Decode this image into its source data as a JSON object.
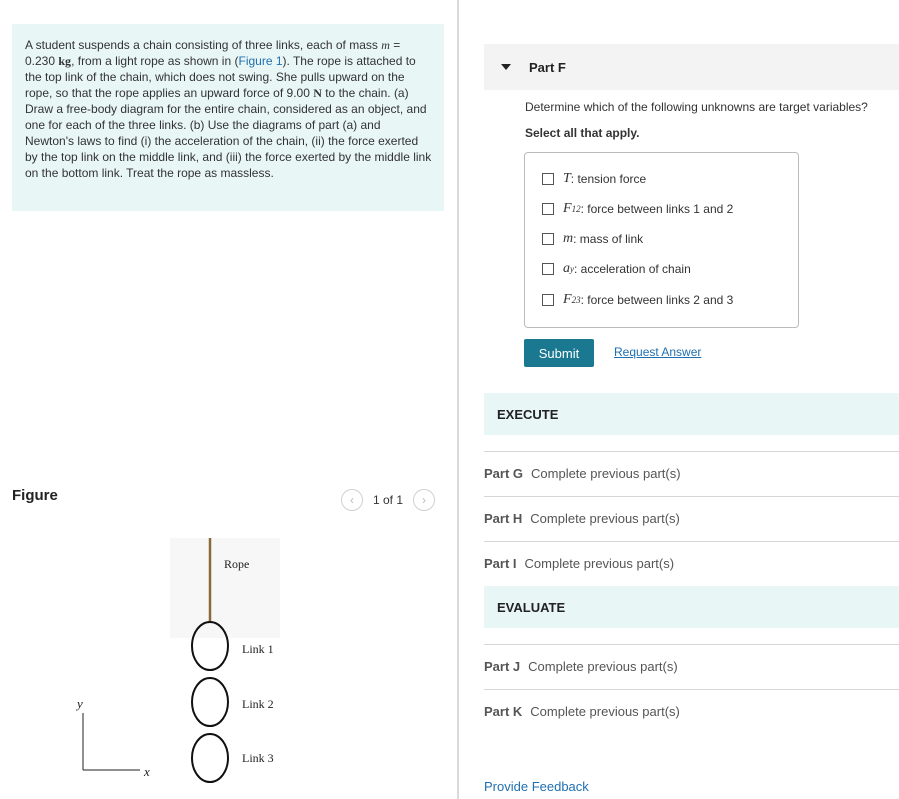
{
  "problem": {
    "text_1": "A student suspends a chain consisting of three links, each of mass",
    "mass_symbol": "m",
    "mass_eq": " = 0.230 ",
    "mass_unit": "kg",
    "text_2": ", from a light rope as shown in (",
    "figure_link": "Figure 1",
    "text_3": "). The rope is attached to the top link of the chain, which does not swing. She pulls upward on the rope, so that the rope applies an upward force of",
    "force_value": "9.00 ",
    "force_unit": "N",
    "text_4": " to the chain. (a) Draw a free-body diagram for the entire chain, considered as an object, and one for each of the three links. (b) Use the diagrams of part (a) and Newton's laws to find (i) the acceleration of the chain, (ii) the force exerted by the top link on the middle link, and (iii) the force exerted by the middle link on the bottom link. Treat the rope as massless."
  },
  "figure": {
    "title": "Figure",
    "pager_text": "1 of 1",
    "prev_icon": "chevron-left-icon",
    "next_icon": "chevron-right-icon",
    "labels": {
      "rope": "Rope",
      "link1": "Link 1",
      "link2": "Link 2",
      "link3": "Link 3",
      "y_axis": "y",
      "x_axis": "x"
    }
  },
  "part_f": {
    "title": "Part F",
    "question": "Determine which of the following unknowns are target variables?",
    "instruction": "Select all that apply.",
    "options": [
      {
        "symbol": "T",
        "sub": "",
        "desc": ": tension force",
        "checked": false
      },
      {
        "symbol": "F",
        "sub": "12",
        "desc": ": force between links 1 and 2",
        "checked": false
      },
      {
        "symbol": "m",
        "sub": "",
        "desc": ": mass of link",
        "checked": false
      },
      {
        "symbol": "a",
        "sub": "y",
        "desc": ": acceleration of chain",
        "checked": false
      },
      {
        "symbol": "F",
        "sub": "23",
        "desc": ": force between links 2 and 3",
        "checked": false
      }
    ],
    "submit_label": "Submit",
    "request_answer_label": "Request Answer"
  },
  "sections": {
    "execute": "EXECUTE",
    "evaluate": "EVALUATE"
  },
  "parts": [
    {
      "label": "Part G",
      "status": "Complete previous part(s)"
    },
    {
      "label": "Part H",
      "status": "Complete previous part(s)"
    },
    {
      "label": "Part I",
      "status": "Complete previous part(s)"
    },
    {
      "label": "Part J",
      "status": "Complete previous part(s)"
    },
    {
      "label": "Part K",
      "status": "Complete previous part(s)"
    }
  ],
  "feedback_label": "Provide Feedback",
  "colors": {
    "accent": "#1a7890",
    "link": "#1f6fb0",
    "band": "#e9f6f6"
  }
}
